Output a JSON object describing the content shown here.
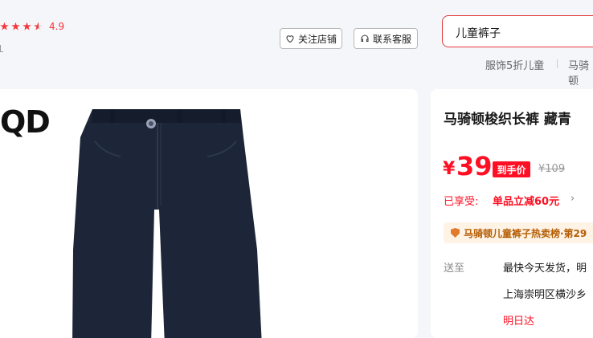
{
  "shop": {
    "rating": "4.9"
  },
  "buttons": {
    "follow": "关注店铺",
    "service": "联系客服"
  },
  "search": {
    "query": "儿童裤子"
  },
  "hotwords": [
    "服饰5折儿童",
    "马骑顿"
  ],
  "gallery": {
    "brand_text": "QD"
  },
  "product": {
    "title": "马骑顿梭织长裤 藏青",
    "price_symbol": "¥",
    "price": "39",
    "price_tag": "到手价",
    "original_price": "¥109",
    "enjoyed_label": "已享受:",
    "discount": "单品立减60元",
    "rank_text": "马骑顿儿童裤子热卖榜·第29"
  },
  "shipping": {
    "label": "送至",
    "line1": "最快今天发货，明",
    "line2": "上海崇明区横沙乡",
    "line3": "明日达"
  },
  "colors": {
    "accent": "#ff0f23",
    "pants": "#1c2638"
  }
}
